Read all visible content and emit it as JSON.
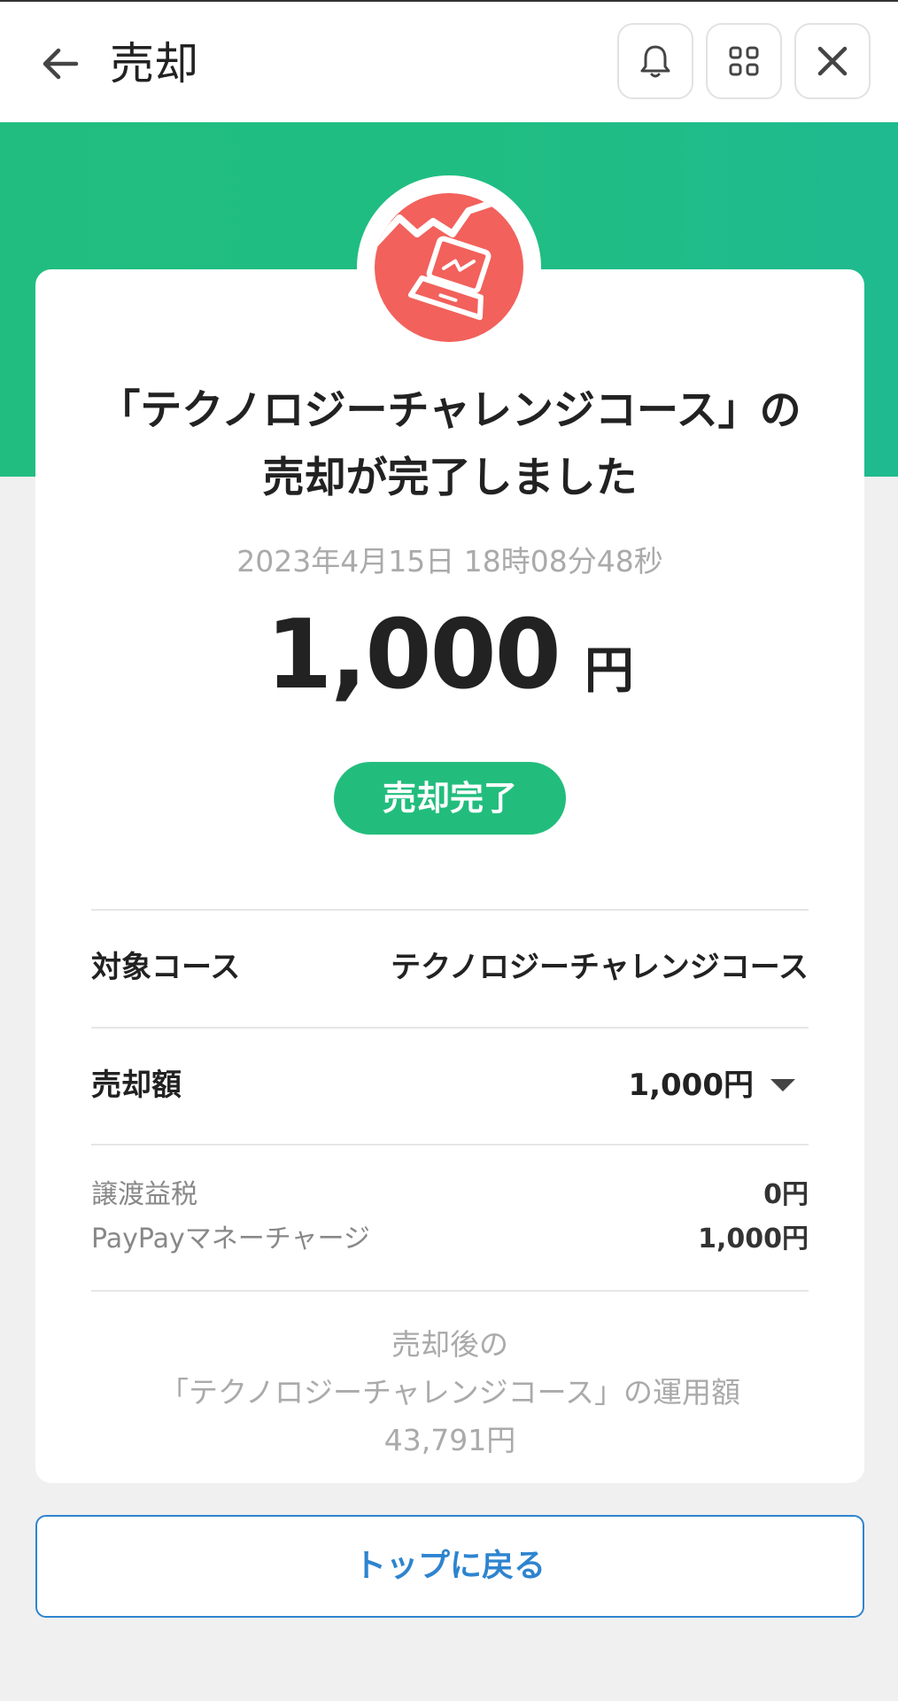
{
  "header": {
    "title": "売却",
    "icons": [
      "back-arrow-icon",
      "bell-icon",
      "apps-grid-icon",
      "close-icon"
    ]
  },
  "colors": {
    "brand_green": "#21bd80",
    "icon_red": "#f2615c",
    "link_blue": "#2e84cf"
  },
  "result": {
    "title_line1": "「テクノロジーチャレンジコース」の",
    "title_line2": "売却が完了しました",
    "datetime": "2023年4月15日 18時08分48秒",
    "amount": "1,000",
    "amount_unit": "円",
    "status": "売却完了"
  },
  "details": {
    "course_label": "対象コース",
    "course_value": "テクノロジーチャレンジコース",
    "sale_label": "売却額",
    "sale_value": "1,000円",
    "tax_label": "譲渡益税",
    "tax_value": "0円",
    "charge_label": "PayPayマネーチャージ",
    "charge_value": "1,000円"
  },
  "after": {
    "line1": "売却後の",
    "line2": "「テクノロジーチャレンジコース」の運用額",
    "line3": "43,791円"
  },
  "footer": {
    "button_label": "トップに戻る"
  }
}
